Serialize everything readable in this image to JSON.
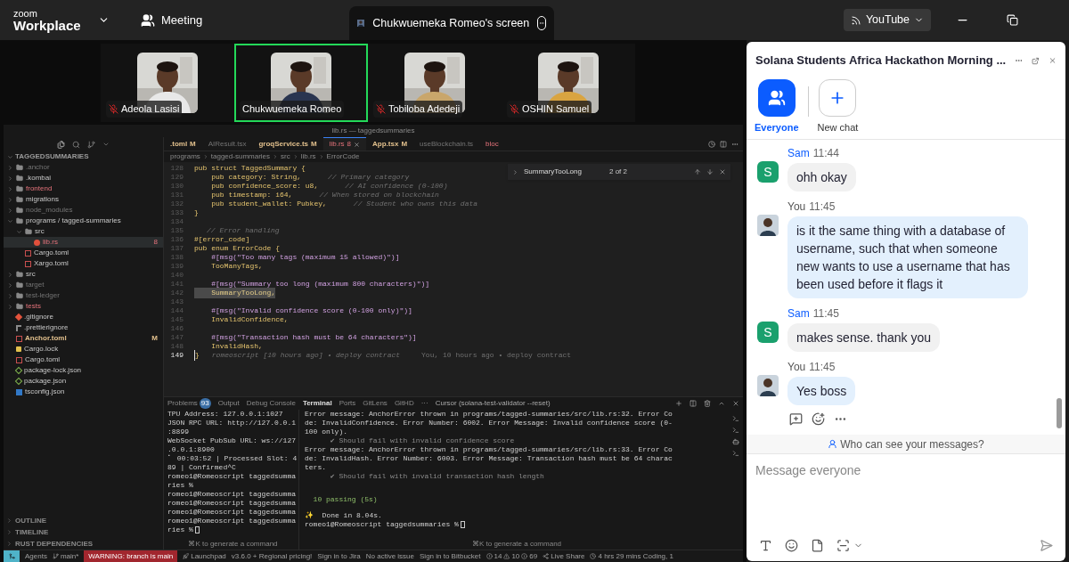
{
  "top_bar": {
    "logo_small": "zoom",
    "logo_large": "Workplace",
    "meeting_label": "Meeting",
    "share_tab": "Chukwuemeka Romeo's screen",
    "youtube_button": "YouTube"
  },
  "participants": [
    {
      "name": "Adeola Lasisi",
      "muted": true,
      "speaking": false
    },
    {
      "name": "Chukwuemeka Romeo",
      "muted": false,
      "speaking": true
    },
    {
      "name": "Tobiloba Adedeji",
      "muted": true,
      "speaking": false
    },
    {
      "name": "OSHIN Samuel",
      "muted": true,
      "speaking": false
    }
  ],
  "shared_screen": {
    "window_title": "lib.rs — taggedsummaries",
    "explorer": {
      "root": "TAGGEDSUMMARIES",
      "items": [
        {
          "label": ".anchor",
          "kind": "folder",
          "expanded": false,
          "selected": false,
          "ignored": true,
          "error": false,
          "modified": false
        },
        {
          "label": ".kombai",
          "kind": "folder",
          "expanded": false,
          "selected": false,
          "ignored": false,
          "error": false,
          "modified": false
        },
        {
          "label": "frontend",
          "kind": "folder",
          "expanded": false,
          "selected": false,
          "ignored": false,
          "error": true,
          "modified": false
        },
        {
          "label": "migrations",
          "kind": "folder",
          "expanded": false,
          "selected": false,
          "ignored": false,
          "error": false,
          "modified": false
        },
        {
          "label": "node_modules",
          "kind": "folder",
          "expanded": false,
          "selected": false,
          "ignored": true,
          "error": false,
          "modified": false
        },
        {
          "label": "programs / tagged-summaries",
          "kind": "folder",
          "expanded": true,
          "selected": false,
          "ignored": false,
          "error": false,
          "modified": false,
          "children": [
            {
              "label": "src",
              "kind": "folder",
              "expanded": true,
              "selected": false,
              "ignored": false,
              "error": false,
              "modified": false,
              "children": [
                {
                  "label": "lib.rs",
                  "kind": "rust",
                  "selected": true,
                  "ignored": false,
                  "error": true,
                  "modified": false,
                  "badge": "8"
                }
              ]
            },
            {
              "label": "Cargo.toml",
              "kind": "toml",
              "selected": false,
              "ignored": false,
              "error": false,
              "modified": false
            },
            {
              "label": "Xargo.toml",
              "kind": "toml",
              "selected": false,
              "ignored": false,
              "error": false,
              "modified": false
            }
          ]
        },
        {
          "label": "src",
          "kind": "folder",
          "expanded": false,
          "selected": false,
          "ignored": false,
          "error": false,
          "modified": false
        },
        {
          "label": "target",
          "kind": "folder",
          "expanded": false,
          "selected": false,
          "ignored": true,
          "error": false,
          "modified": false
        },
        {
          "label": "test-ledger",
          "kind": "folder",
          "expanded": false,
          "selected": false,
          "ignored": true,
          "error": false,
          "modified": false
        },
        {
          "label": "tests",
          "kind": "folder",
          "expanded": false,
          "selected": false,
          "ignored": false,
          "error": true,
          "modified": false
        },
        {
          "label": ".gitignore",
          "kind": "git",
          "selected": false,
          "ignored": false,
          "error": false,
          "modified": false
        },
        {
          "label": ".prettierignore",
          "kind": "prettier",
          "selected": false,
          "ignored": false,
          "error": false,
          "modified": false
        },
        {
          "label": "Anchor.toml",
          "kind": "toml",
          "selected": false,
          "ignored": false,
          "error": false,
          "modified": true,
          "badge": "M"
        },
        {
          "label": "Cargo.lock",
          "kind": "lock",
          "selected": false,
          "ignored": false,
          "error": false,
          "modified": false
        },
        {
          "label": "Cargo.toml",
          "kind": "toml",
          "selected": false,
          "ignored": false,
          "error": false,
          "modified": false
        },
        {
          "label": "package-lock.json",
          "kind": "npm",
          "selected": false,
          "ignored": false,
          "error": false,
          "modified": false
        },
        {
          "label": "package.json",
          "kind": "npm",
          "selected": false,
          "ignored": false,
          "error": false,
          "modified": false
        },
        {
          "label": "tsconfig.json",
          "kind": "tsconfig",
          "selected": false,
          "ignored": false,
          "error": false,
          "modified": false
        }
      ]
    },
    "sections": [
      "OUTLINE",
      "TIMELINE",
      "RUST DEPENDENCIES"
    ],
    "tabs": [
      {
        "label": ".toml",
        "badge": "M",
        "selected": false,
        "ignored": false,
        "error": false,
        "modified": true
      },
      {
        "label": "AIResult.tsx",
        "selected": false,
        "ignored": true,
        "error": false,
        "modified": false
      },
      {
        "label": "groqService.ts",
        "badge": "M",
        "selected": false,
        "ignored": false,
        "error": false,
        "modified": true
      },
      {
        "label": "lib.rs",
        "badge": "8",
        "selected": true,
        "ignored": false,
        "error": true,
        "modified": false
      },
      {
        "label": "App.tsx",
        "badge": "M",
        "selected": false,
        "ignored": false,
        "error": false,
        "modified": true
      },
      {
        "label": "useBlockchain.ts",
        "selected": false,
        "ignored": true,
        "error": false,
        "modified": false
      },
      {
        "label": "bloc",
        "selected": false,
        "ignored": false,
        "error": true,
        "modified": false
      }
    ],
    "breadcrumb": [
      "programs",
      "tagged-summaries",
      "src",
      "lib.rs",
      "ErrorCode"
    ],
    "find": {
      "query": "SummaryTooLong",
      "count": "2 of 2"
    },
    "code_lines": [
      {
        "number": "128",
        "kind": "plain",
        "code": "pub struct TaggedSummary {"
      },
      {
        "number": "129",
        "kind": "plain",
        "code": "    pub category: String,",
        "comment": "// Primary category"
      },
      {
        "number": "130",
        "kind": "plain",
        "code": "    pub confidence_score: u8,",
        "comment": "// AI confidence (0-100)"
      },
      {
        "number": "131",
        "kind": "plain",
        "code": "    pub timestamp: i64,",
        "comment": "// When stored on blockchain"
      },
      {
        "number": "132",
        "kind": "plain",
        "code": "    pub student_wallet: Pubkey,",
        "comment": "// Student who owns this data"
      },
      {
        "number": "133",
        "kind": "plain",
        "code": "}"
      },
      {
        "number": "134",
        "kind": "plain"
      },
      {
        "number": "135",
        "kind": "plain",
        "comment": "// Error handling"
      },
      {
        "number": "136",
        "kind": "plain",
        "code": "#[error_code]"
      },
      {
        "number": "137",
        "kind": "plain",
        "code": "pub enum ErrorCode {"
      },
      {
        "number": "138",
        "kind": "plain",
        "attr": "    #[msg(\"Too many tags (maximum 15 allowed)\")]"
      },
      {
        "number": "139",
        "kind": "plain",
        "code": "    TooManyTags,"
      },
      {
        "number": "140",
        "kind": "plain"
      },
      {
        "number": "141",
        "kind": "plain",
        "attr": "    #[msg(\"Summary too long (maximum 800 characters)\")]"
      },
      {
        "number": "142",
        "kind": "match",
        "code": "    SummaryTooLong,"
      },
      {
        "number": "143",
        "kind": "plain"
      },
      {
        "number": "144",
        "kind": "plain",
        "attr": "    #[msg(\"Invalid confidence score (0-100 only)\")]"
      },
      {
        "number": "145",
        "kind": "plain",
        "code": "    InvalidConfidence,"
      },
      {
        "number": "146",
        "kind": "plain"
      },
      {
        "number": "147",
        "kind": "plain",
        "attr": "    #[msg(\"Transaction hash must be 64 characters\")]"
      },
      {
        "number": "148",
        "kind": "plain",
        "code": "    InvalidHash,"
      },
      {
        "number": "149",
        "kind": "current",
        "code": "}",
        "comment": "romeoscript [10 hours ago] • deploy contract",
        "blame": "You, 10 hours ago • deploy contract"
      }
    ],
    "panel_tabs": [
      {
        "label": "Problems",
        "badge": "93",
        "selected": false
      },
      {
        "label": "Output",
        "selected": false
      },
      {
        "label": "Debug Console",
        "selected": false
      },
      {
        "label": "Terminal",
        "selected": true
      },
      {
        "label": "Ports",
        "selected": false
      },
      {
        "label": "GitLens",
        "selected": false
      },
      {
        "label": "GitHD",
        "selected": false
      },
      {
        "label": "···",
        "selected": false
      }
    ],
    "terminal_title": "Cursor (solana-test-validator --reset)",
    "terminal_left": [
      "TPU Address: 127.0.0.1:1027",
      "JSON RPC URL: http://127.0.0.1",
      ":8899",
      "WebSocket PubSub URL: ws://127",
      ".0.0.1:8900",
      "⠁ 00:03:52 | Processed Slot: 4",
      "89 | Confirmed^C",
      "romeo1@Romeoscript taggedsumma",
      "ries %",
      "romeo1@Romeoscript taggedsumma",
      "romeo1@Romeoscript taggedsumma",
      "romeo1@Romeoscript taggedsumma",
      "romeo1@Romeoscript taggedsumma",
      "ries %"
    ],
    "terminal_right": [
      {
        "kind": "plain",
        "text": "Error message: AnchorError thrown in programs/tagged-summaries/src/lib.rs:32. Error Co"
      },
      {
        "kind": "plain",
        "text": "de: InvalidConfidence. Error Number: 6002. Error Message: Invalid confidence score (0-"
      },
      {
        "kind": "plain",
        "text": "100 only)."
      },
      {
        "kind": "dim",
        "text": "      ✔ Should fail with invalid confidence score"
      },
      {
        "kind": "plain",
        "text": "Error message: AnchorError thrown in programs/tagged-summaries/src/lib.rs:33. Error Co"
      },
      {
        "kind": "plain",
        "text": "de: InvalidHash. Error Number: 6003. Error Message: Transaction hash must be 64 charac"
      },
      {
        "kind": "plain",
        "text": "ters."
      },
      {
        "kind": "dim",
        "text": "      ✔ Should fail with invalid transaction hash length"
      },
      {
        "kind": "gap"
      },
      {
        "kind": "gap"
      },
      {
        "kind": "pass",
        "text": "  10 passing (5s)"
      },
      {
        "kind": "gap"
      },
      {
        "kind": "plain",
        "text": "✨  Done in 8.04s."
      },
      {
        "kind": "plain",
        "text": "romeo1@Romeoscript taggedsummaries %"
      }
    ],
    "terminal_hints": [
      "⌘K to generate a command",
      "⌘K to generate a command"
    ],
    "status_bar": {
      "agents": "Agents",
      "branch": "main*",
      "warning": "WARNING: branch is main",
      "launchpad": "Launchpad",
      "items": [
        "v3.6.0 + Regional pricing!",
        "Sign in to Jira",
        "No active issue",
        "Sign in to Bitbucket"
      ],
      "errors": "14",
      "warnings": "10",
      "infos": "69",
      "live_share": "Live Share",
      "coding": "4 hrs 29 mins Coding, 1"
    }
  },
  "chat": {
    "title": "Solana Students Africa Hackathon Morning ...",
    "recipients": [
      {
        "label": "Everyone",
        "kind": "everyone",
        "selected": true
      },
      {
        "label": "New chat",
        "kind": "new",
        "selected": false
      }
    ],
    "messages": [
      {
        "sender": "Sam",
        "time": "11:44",
        "text": "ohh okay",
        "self": false,
        "avatar": "S",
        "color": "#1aa06d"
      },
      {
        "sender": "You",
        "time": "11:45",
        "text": "is it the same thing with a database of username, such that when someone new wants to use a username that has been used before it flags it",
        "self": true
      },
      {
        "sender": "Sam",
        "time": "11:45",
        "text": "makes sense. thank you",
        "self": false,
        "avatar": "S",
        "color": "#1aa06d"
      },
      {
        "sender": "You",
        "time": "11:45",
        "text": "Yes boss",
        "self": true
      }
    ],
    "visibility_link": "Who can see your messages?",
    "input": {
      "placeholder": "Message everyone"
    }
  }
}
